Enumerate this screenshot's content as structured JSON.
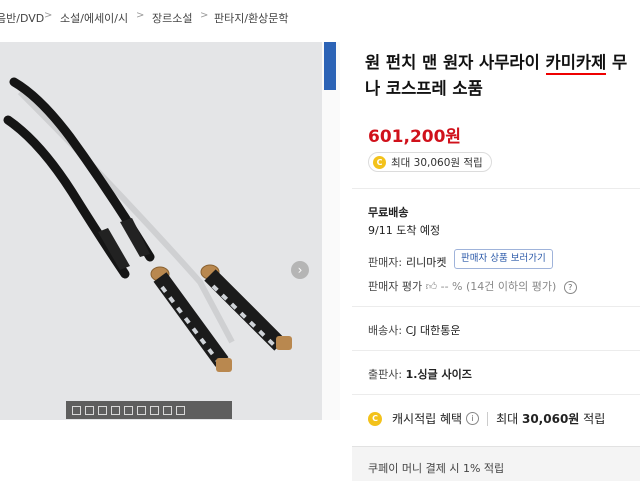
{
  "breadcrumb": {
    "items": [
      "음반/DVD",
      "소설/에세이/시",
      "장르소설",
      "판타지/환상문학"
    ],
    "separator": ">"
  },
  "image_toolbar": {
    "tools": [
      "zoom-in-icon",
      "zoom-out-icon",
      "fit-icon",
      "rotate-icon",
      "crop-icon",
      "grid-icon",
      "copy-icon",
      "print-icon",
      "share-icon"
    ]
  },
  "product": {
    "title_part1": "원 펀치 맨 원자 사무라이 ",
    "title_highlight": "카미카제",
    "title_part2": " 무",
    "title_line2": "나 코스프레 소품",
    "price": "601,200원",
    "points_label": "최대 30,060원 적립"
  },
  "shipping": {
    "label": "무료배송",
    "eta": "9/11 도착 예정"
  },
  "seller": {
    "label": "판매자:",
    "name": "리니마켓",
    "button": "판매자 상품 보러가기",
    "rating_label": "판매자 평가",
    "rating_value": "-- %",
    "rating_note": "(14건 이하의 평가)"
  },
  "delivery": {
    "label": "배송사:",
    "value": "CJ 대한통운"
  },
  "publisher": {
    "label": "출판사:",
    "value": "1.싱글 사이즈"
  },
  "cash": {
    "label": "캐시적립 혜택",
    "max_label": "최대",
    "max_value": "30,060원",
    "suffix": "적립"
  },
  "payco": {
    "text": "쿠페이 머니 결제 시 1% 적립"
  },
  "colors": {
    "price": "#d0111b",
    "coin": "#f3c21b",
    "highlight_underline": "#e00000",
    "link": "#2a58a8"
  }
}
